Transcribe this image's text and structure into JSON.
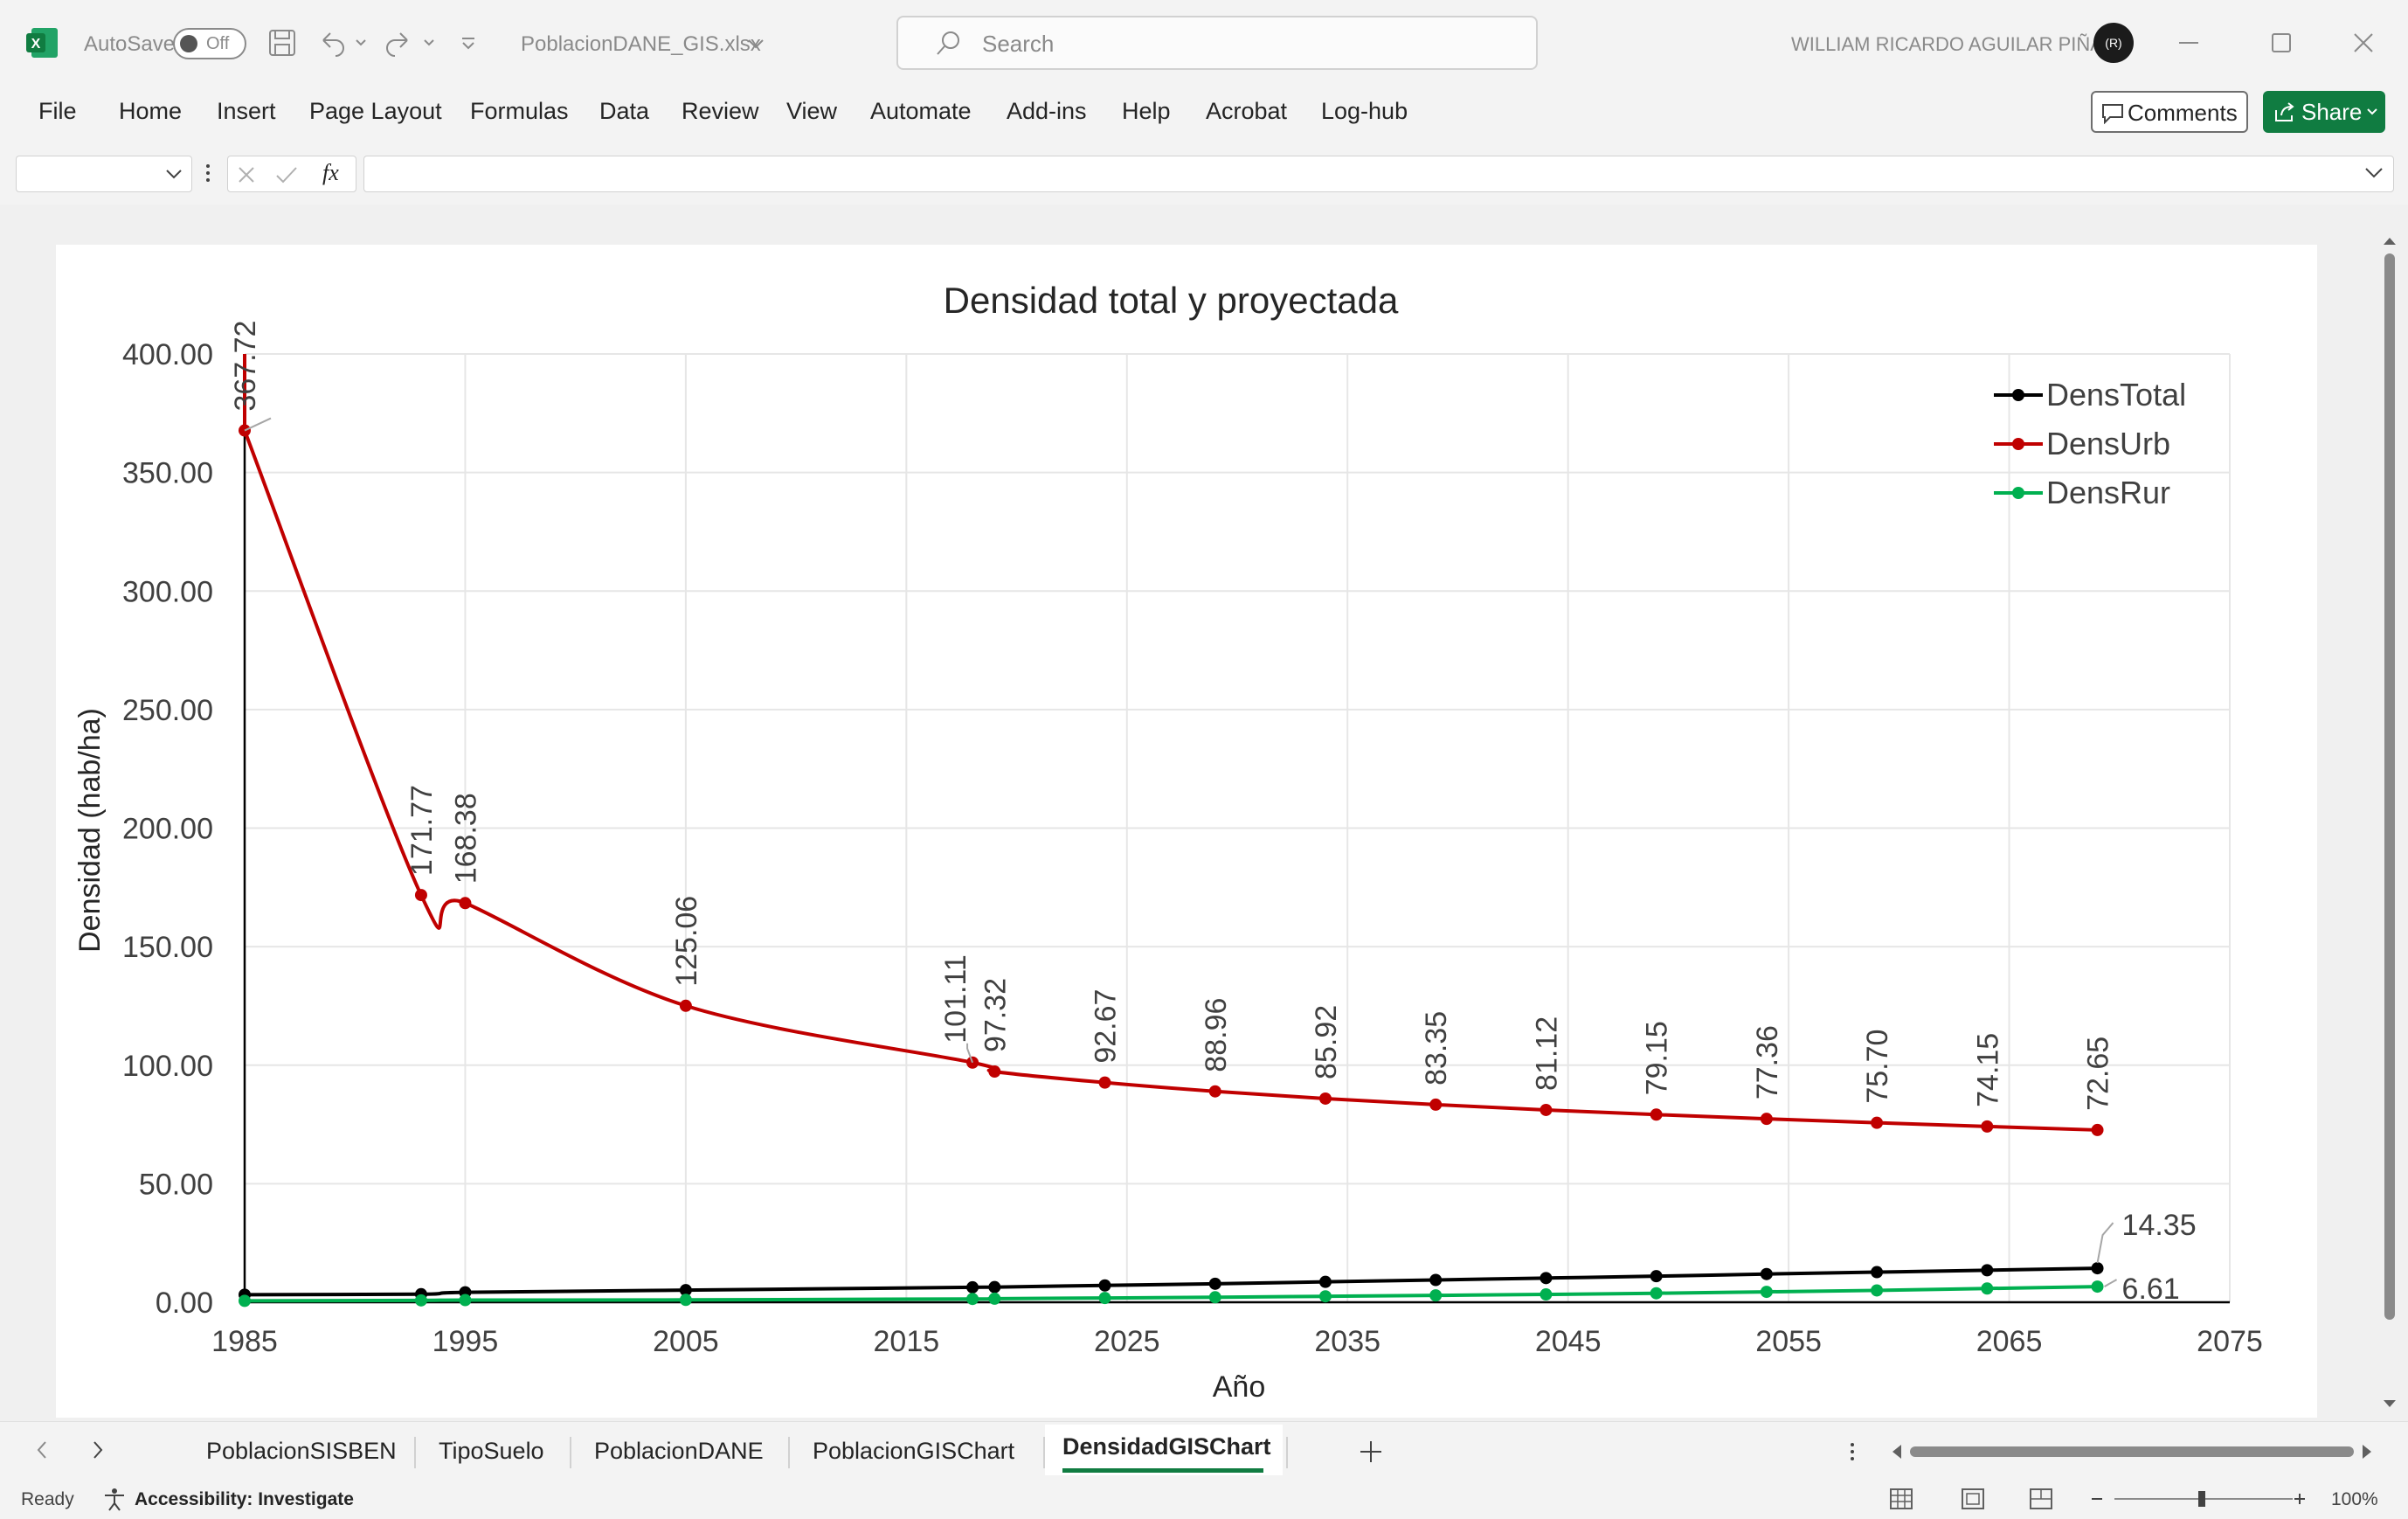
{
  "titlebar": {
    "autosave_label": "AutoSave",
    "autosave_state": "Off",
    "filename": "PoblacionDANE_GIS.xlsx",
    "search_placeholder": "Search",
    "user_name": "WILLIAM RICARDO AGUILAR PIÑA",
    "avatar_initials": "(R)"
  },
  "ribbon": {
    "tabs": [
      "File",
      "Home",
      "Insert",
      "Page Layout",
      "Formulas",
      "Data",
      "Review",
      "View",
      "Automate",
      "Add-ins",
      "Help",
      "Acrobat",
      "Log-hub"
    ],
    "comments_label": "Comments",
    "share_label": "Share"
  },
  "formula_bar": {
    "fx_label": "fx",
    "value": ""
  },
  "chart_data": {
    "type": "line",
    "title": "Densidad total y proyectada",
    "xlabel": "Año",
    "ylabel": "Densidad (hab/ha)",
    "xlim": [
      1985,
      2075
    ],
    "ylim": [
      0,
      400
    ],
    "xticks": [
      1985,
      1995,
      2005,
      2015,
      2025,
      2035,
      2045,
      2055,
      2065,
      2075
    ],
    "yticks": [
      "0.00",
      "50.00",
      "100.00",
      "150.00",
      "200.00",
      "250.00",
      "300.00",
      "350.00",
      "400.00"
    ],
    "grid": true,
    "legend": "top-right",
    "x": [
      1985,
      1993,
      1995,
      2005,
      2018,
      2019,
      2024,
      2029,
      2034,
      2039,
      2044,
      2049,
      2054,
      2059,
      2064,
      2069
    ],
    "series": [
      {
        "name": "DensTotal",
        "color": "#000000",
        "values": [
          3.2,
          3.4,
          4.2,
          5.1,
          6.3,
          6.4,
          7.1,
          7.8,
          8.6,
          9.4,
          10.2,
          11.0,
          11.9,
          12.7,
          13.5,
          14.35
        ],
        "labels": [
          "",
          "",
          "",
          "",
          "",
          "",
          "",
          "",
          "",
          "",
          "",
          "",
          "",
          "",
          "",
          "14.35"
        ]
      },
      {
        "name": "DensUrb",
        "color": "#c00000",
        "values": [
          367.72,
          171.77,
          168.38,
          125.06,
          101.11,
          97.32,
          92.67,
          88.96,
          85.92,
          83.35,
          81.12,
          79.15,
          77.36,
          75.7,
          74.15,
          72.65
        ],
        "labels": [
          "367.72",
          "171.77",
          "168.38",
          "125.06",
          "101.11",
          "97.32",
          "92.67",
          "88.96",
          "85.92",
          "83.35",
          "81.12",
          "79.15",
          "77.36",
          "75.70",
          "74.15",
          "72.65"
        ]
      },
      {
        "name": "DensRur",
        "color": "#00b050",
        "values": [
          0.6,
          0.8,
          0.9,
          1.0,
          1.4,
          1.5,
          1.8,
          2.1,
          2.5,
          2.9,
          3.3,
          3.8,
          4.4,
          5.0,
          5.8,
          6.61
        ],
        "labels": [
          "",
          "",
          "",
          "",
          "",
          "",
          "",
          "",
          "",
          "",
          "",
          "",
          "",
          "",
          "",
          "6.61"
        ]
      }
    ]
  },
  "sheet_tabs": [
    "PoblacionSISBEN",
    "TipoSuelo",
    "PoblacionDANE",
    "PoblacionGISChart",
    "DensidadGISChart"
  ],
  "active_sheet": "DensidadGISChart",
  "statusbar": {
    "ready": "Ready",
    "accessibility": "Accessibility: Investigate",
    "zoom": "100%"
  }
}
